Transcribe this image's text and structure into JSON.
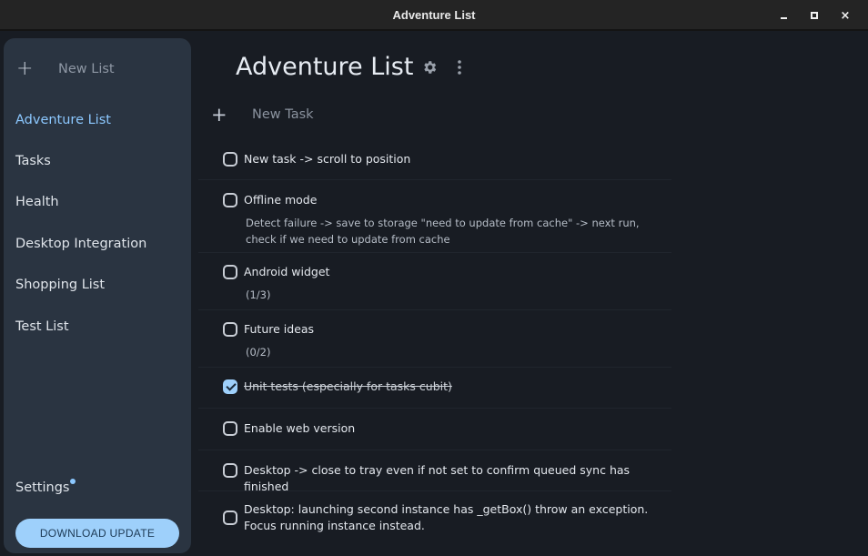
{
  "window": {
    "title": "Adventure List",
    "controls": {
      "minimize": "minimize",
      "maximize": "maximize",
      "close": "×"
    }
  },
  "sidebar": {
    "new_list_label": "New List",
    "items": [
      {
        "label": "Adventure List",
        "active": true
      },
      {
        "label": "Tasks",
        "active": false
      },
      {
        "label": "Health",
        "active": false
      },
      {
        "label": "Desktop Integration",
        "active": false
      },
      {
        "label": "Shopping List",
        "active": false
      },
      {
        "label": "Test List",
        "active": false
      }
    ],
    "settings_label": "Settings",
    "download_label": "DOWNLOAD UPDATE"
  },
  "main": {
    "title": "Adventure List",
    "new_task_placeholder": "New Task",
    "tasks": [
      {
        "title": "New task -> scroll to position",
        "completed": false
      },
      {
        "title": "Offline mode",
        "completed": false,
        "description": "Detect failure -> save to storage \"need to update from cache\" -> next run, check if we need to update from cache"
      },
      {
        "title": "Android widget",
        "completed": false,
        "subtasks": "(1/3)"
      },
      {
        "title": "Future ideas",
        "completed": false,
        "subtasks": "(0/2)"
      },
      {
        "title": "Unit tests (especially for tasks cubit)",
        "completed": true
      },
      {
        "title": "Enable web version",
        "completed": false
      },
      {
        "title": "Desktop -> close to tray even if not set to confirm queued sync has finished",
        "completed": false
      },
      {
        "title": "Desktop: launching second instance has _getBox() throw an exception. Focus running instance instead.",
        "completed": false
      }
    ]
  },
  "colors": {
    "accent": "#8cc8ff",
    "button_bg": "#9ed0fb",
    "sidebar_bg": "#2a3441",
    "main_bg": "#181c23",
    "titlebar_bg": "#242424"
  }
}
